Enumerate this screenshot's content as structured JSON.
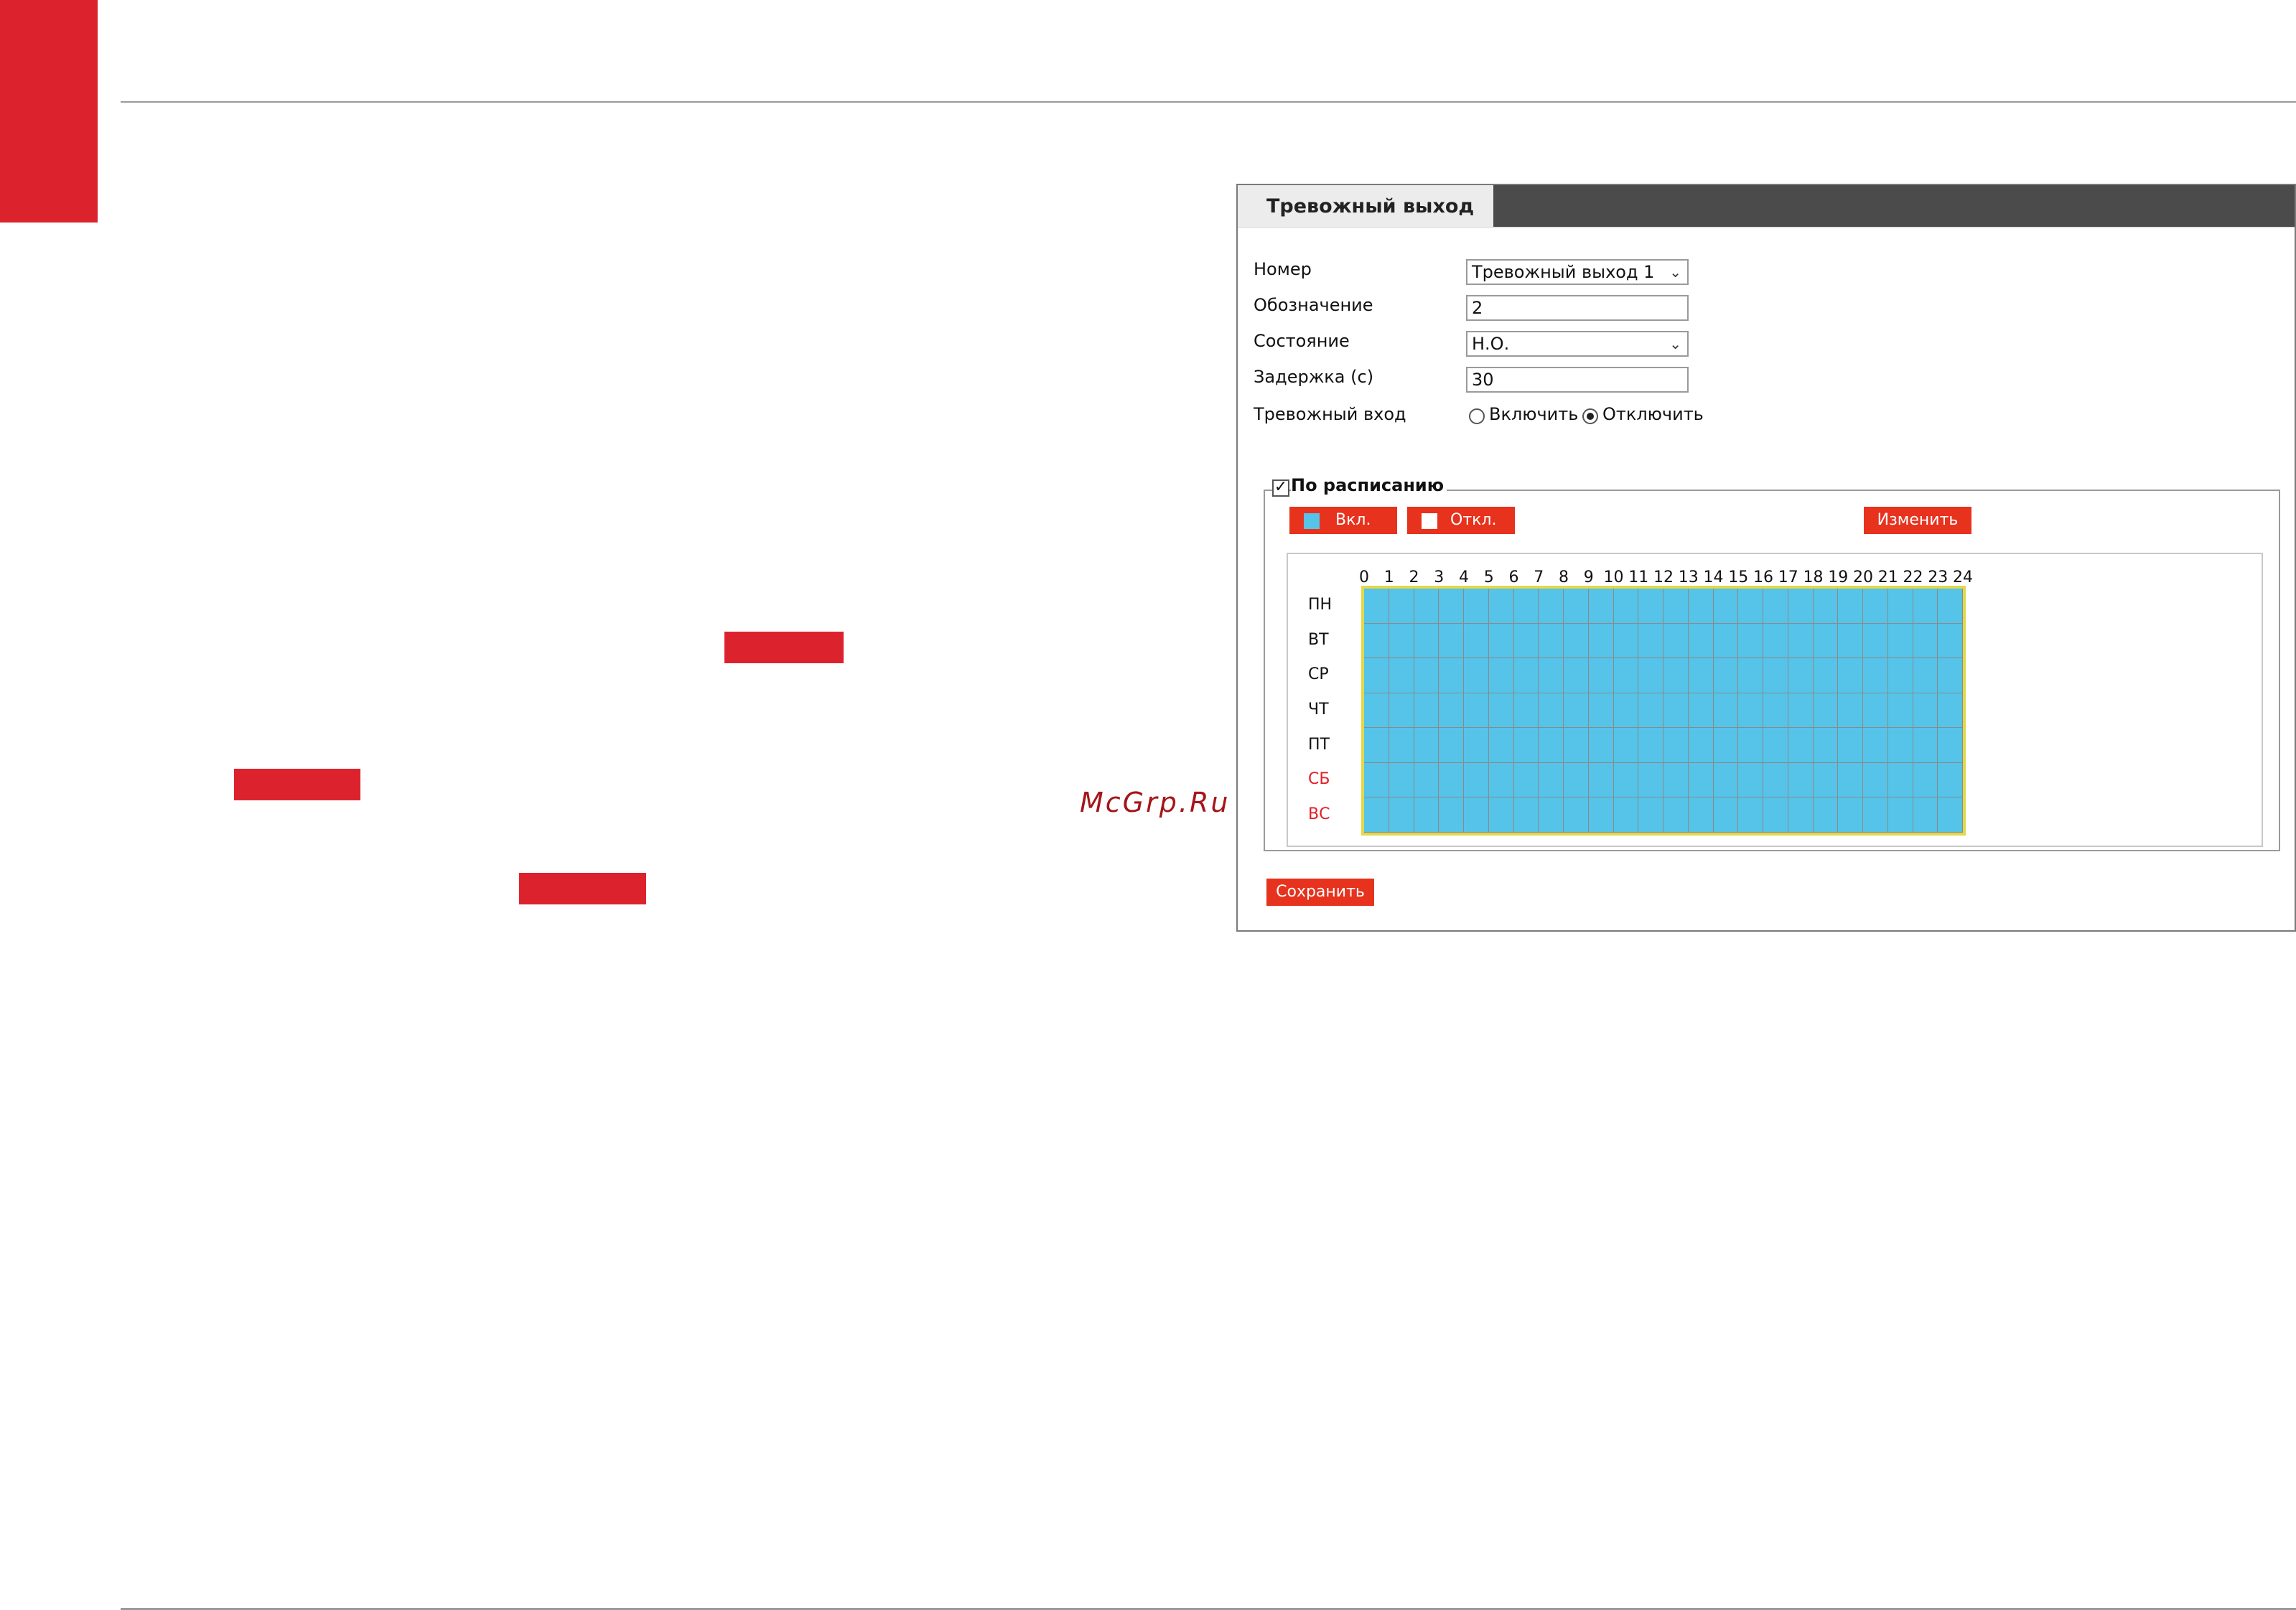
{
  "watermark": "McGrp.Ru",
  "panel": {
    "tab_title": "Тревожный выход",
    "fields": {
      "number_label": "Номер",
      "number_value": "Тревожный выход 1",
      "name_label": "Обозначение",
      "name_value": "2",
      "state_label": "Состояние",
      "state_value": "Н.О.",
      "delay_label": "Задержка (с)",
      "delay_value": "30",
      "alarm_input_label": "Тревожный вход",
      "enable_label": "Включить",
      "disable_label": "Отключить",
      "alarm_input_selected": "disable"
    },
    "schedule": {
      "checkbox_label": "По расписанию",
      "checked": true,
      "on_button": "Вкл.",
      "off_button": "Откл.",
      "edit_button": "Изменить",
      "hours": [
        "0",
        "1",
        "2",
        "3",
        "4",
        "5",
        "6",
        "7",
        "8",
        "9",
        "10",
        "11",
        "12",
        "13",
        "14",
        "15",
        "16",
        "17",
        "18",
        "19",
        "20",
        "21",
        "22",
        "23",
        "24"
      ],
      "days": [
        "ПН",
        "ВТ",
        "СР",
        "ЧТ",
        "ПТ",
        "СБ",
        "ВС"
      ],
      "weekend_days": [
        "СБ",
        "ВС"
      ],
      "all_slots_active": true,
      "colors": {
        "active": "#56c3e8",
        "selection_border": "#e2d84a",
        "weekend": "#e41e26"
      }
    },
    "save_button": "Сохранить"
  },
  "colors": {
    "brand_red": "#dc232d",
    "button_red": "#e7321e"
  }
}
